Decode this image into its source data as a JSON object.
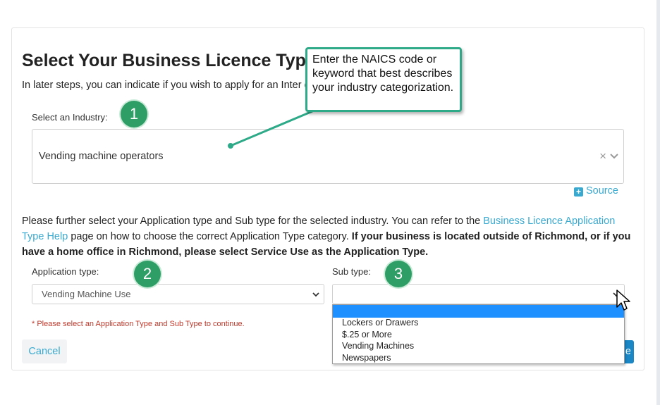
{
  "page": {
    "title": "Select Your Business Licence Type",
    "intro": "In later steps, you can indicate if you wish to apply for an Inter                                                         e."
  },
  "industry": {
    "label": "Select an Industry:",
    "value": "Vending machine operators",
    "clear_glyph": "×",
    "source_label": "Source"
  },
  "instructions": {
    "part1": "Please further select your Application type and Sub type for the selected industry. You can refer to the ",
    "link": "Business Licence Application Type Help",
    "part2": " page on how to choose the correct Application Type category. ",
    "bold": "If your business is located outside of Richmond, or if you have a home office in Richmond, please select Service Use as the Application Type."
  },
  "application_type": {
    "label": "Application type:",
    "value": "Vending Machine Use"
  },
  "sub_type": {
    "label": "Sub type:",
    "value": "",
    "options": [
      "",
      "Lockers or Drawers",
      "$.25 or More",
      "Vending Machines",
      "Newspapers"
    ]
  },
  "error": "* Please select an Application Type and Sub Type to continue.",
  "buttons": {
    "cancel": "Cancel",
    "continue_partial": "e"
  },
  "annotations": {
    "callout": "Enter the NAICS code or keyword that best describes your industry categorization.",
    "steps": [
      "1",
      "2",
      "3"
    ]
  },
  "colors": {
    "link": "#3aa9cf",
    "primary": "#1b87c5",
    "badge": "#2e9d66",
    "callout_border": "#2eaa88",
    "error": "#c0392b",
    "highlight": "#1e90ff"
  }
}
